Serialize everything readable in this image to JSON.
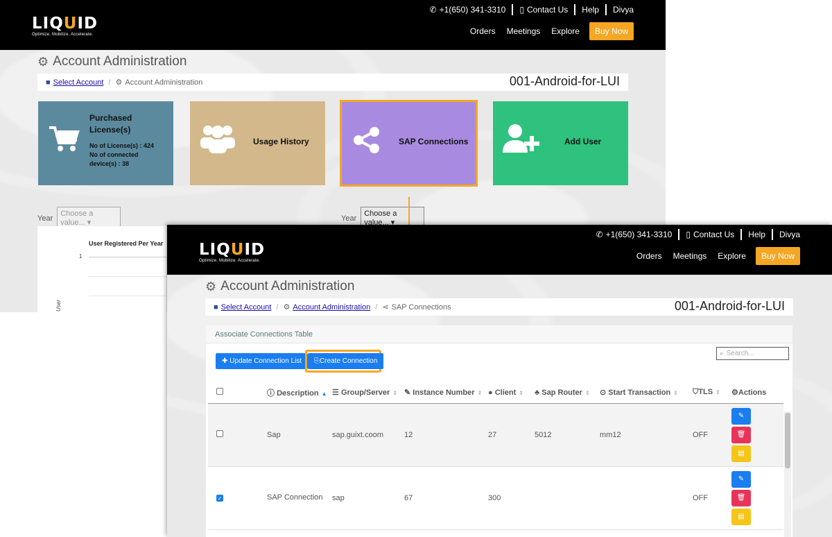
{
  "back": {
    "header": {
      "phone": "+1(650) 341-3310",
      "contact": "Contact Us",
      "help": "Help",
      "user": "Divya",
      "nav": [
        "Orders",
        "Meetings",
        "Explore"
      ],
      "buy": "Buy Now"
    },
    "logo": {
      "word_a": "LIQ",
      "word_u": "U",
      "word_b": "ID",
      "tagline": "Optimize. Mobilize. Accelerate."
    },
    "title": "Account Administration",
    "breadcrumb": {
      "link": "Select Account",
      "current": "Account Administration"
    },
    "account": "001-Android-for-LUI",
    "tiles": {
      "purchased": {
        "title": "Purchased License(s)",
        "line1": "No of License(s) : 424",
        "line2": "No of connected device(s) : 38",
        "color": "#5b8a9e"
      },
      "usage": {
        "title": "Usage History",
        "color": "#d3b88c"
      },
      "sap": {
        "title": "SAP Connections",
        "color": "#a88be0",
        "border": "#f5a623"
      },
      "add": {
        "title": "Add User",
        "color": "#2ec27e"
      }
    },
    "year_label": "Year",
    "year_left_placeholder": "Choose a value...",
    "year_right_value": "Choose a value...",
    "chart": {
      "title": "User Registered Per Year",
      "ytick": "1",
      "ylabel": "User"
    }
  },
  "front": {
    "header": {
      "phone": "+1(650) 341-3310",
      "contact": "Contact Us",
      "help": "Help",
      "user": "Divya",
      "nav": [
        "Orders",
        "Meetings",
        "Explore"
      ],
      "buy": "Buy Now"
    },
    "logo": {
      "word_a": "LIQ",
      "word_u": "U",
      "word_b": "ID",
      "tagline": "Optimize. Mobilize. Accelerate."
    },
    "title": "Account Administration",
    "breadcrumb": {
      "link1": "Select Account",
      "link2": "Account Administration",
      "current": "SAP Connections"
    },
    "account": "001-Android-for-LUI",
    "table_title": "Associate Connections Table",
    "update_btn": "Update Connection List",
    "create_btn": "Create Connection",
    "search_placeholder": "Search...",
    "columns": [
      "Description",
      "Group/Server",
      "Instance Number",
      "Client",
      "Sap Router",
      "Start Transaction",
      "TLS",
      "Actions"
    ],
    "rows": [
      {
        "checked": false,
        "description": "Sap",
        "group": "sap.guixt.coom",
        "instance": "12",
        "client": "27",
        "router": "5012",
        "transaction": "mm12",
        "tls": "OFF"
      },
      {
        "checked": true,
        "description": "SAP Connection",
        "group": "sap",
        "instance": "67",
        "client": "300",
        "router": "",
        "transaction": "",
        "tls": "OFF"
      }
    ],
    "colors": {
      "edit": "#1a7df0",
      "delete": "#e8345a",
      "details": "#f5c518",
      "highlight": "#f5a623"
    }
  }
}
